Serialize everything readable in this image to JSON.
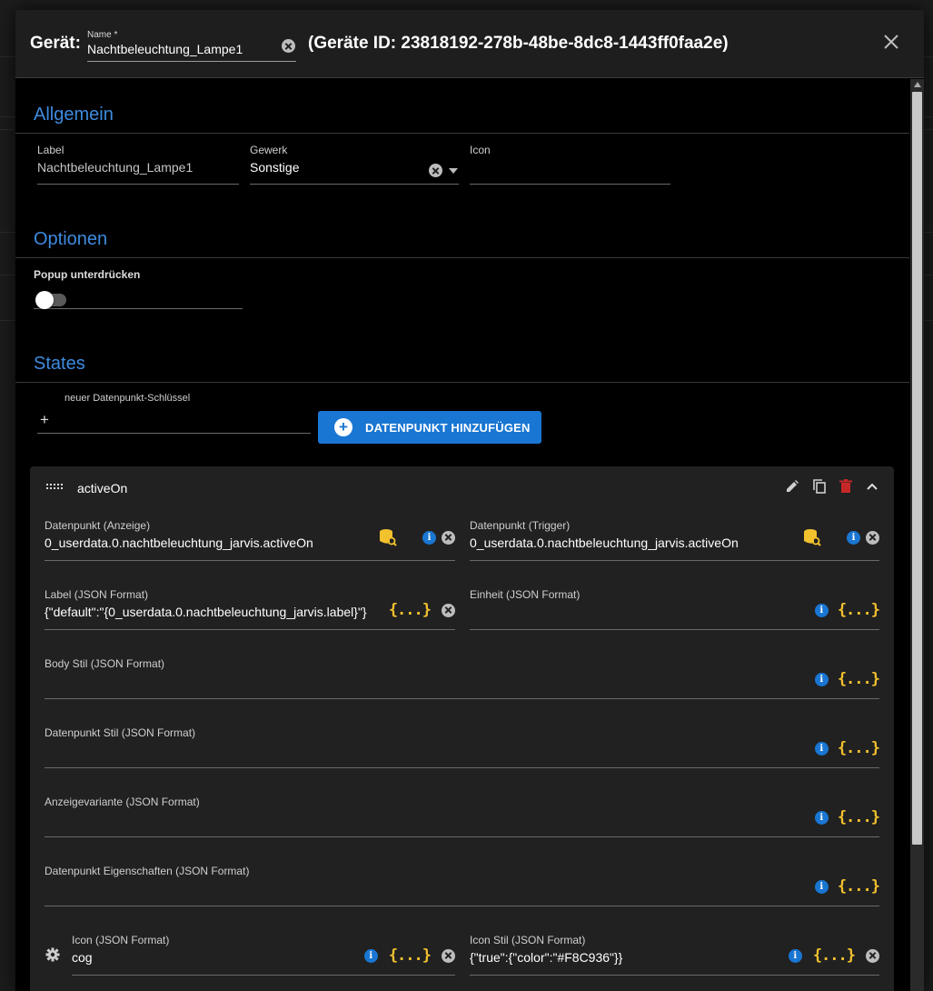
{
  "header": {
    "prefix": "Gerät:",
    "name_label": "Name *",
    "name_value": "Nachtbeleuchtung_Lampe1",
    "device_id": "(Geräte ID: 23818192-278b-48be-8dc8-1443ff0faa2e)"
  },
  "sections": {
    "general": "Allgemein",
    "options": "Optionen",
    "states": "States"
  },
  "general": {
    "label_label": "Label",
    "label_value": "Nachtbeleuchtung_Lampe1",
    "trade_label": "Gewerk",
    "trade_value": "Sonstige",
    "icon_label": "Icon",
    "icon_value": ""
  },
  "options": {
    "popup_label": "Popup unterdrücken",
    "popup_enabled": false
  },
  "states": {
    "new_key_label": "neuer Datenpunkt-Schlüssel",
    "new_key_prefix": "+",
    "add_button": "DATENPUNKT HINZUFÜGEN",
    "card": {
      "title": "activeOn",
      "dp_display_label": "Datenpunkt (Anzeige)",
      "dp_display_value": "0_userdata.0.nachtbeleuchtung_jarvis.activeOn",
      "dp_trigger_label": "Datenpunkt (Trigger)",
      "dp_trigger_value": "0_userdata.0.nachtbeleuchtung_jarvis.activeOn",
      "label_json_label": "Label (JSON Format)",
      "label_json_value": "{\"default\":\"{0_userdata.0.nachtbeleuchtung_jarvis.label}\"}",
      "unit_label": "Einheit (JSON Format)",
      "unit_value": "",
      "body_style_label": "Body Stil (JSON Format)",
      "dp_style_label": "Datenpunkt Stil (JSON Format)",
      "display_variant_label": "Anzeigevariante (JSON Format)",
      "dp_props_label": "Datenpunkt Eigenschaften (JSON Format)",
      "icon_json_label": "Icon (JSON Format)",
      "icon_json_value": "cog",
      "icon_style_label": "Icon Stil (JSON Format)",
      "icon_style_value": "{\"true\":{\"color\":\"#F8C936\"}}"
    }
  },
  "glyphs": {
    "info": "i",
    "braces": "{...}"
  },
  "colors": {
    "accent_blue": "#1976d2",
    "section_title": "#3d8bdf",
    "braces_yellow": "#f2c12e",
    "delete_red": "#c62828"
  }
}
